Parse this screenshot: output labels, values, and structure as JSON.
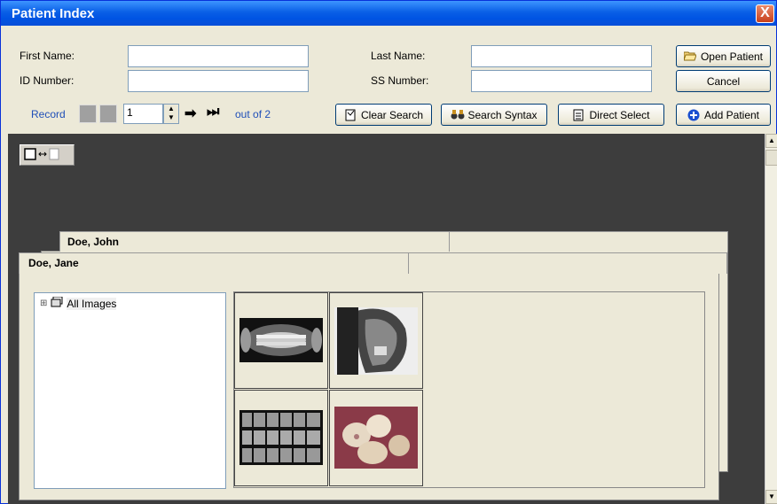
{
  "window": {
    "title": "Patient Index",
    "close_label": "X"
  },
  "search": {
    "first_name_label": "First Name:",
    "first_name_value": "",
    "id_label": "ID Number:",
    "id_value": "",
    "last_name_label": "Last Name:",
    "last_name_value": "",
    "ss_label": "SS Number:",
    "ss_value": ""
  },
  "record_nav": {
    "label": "Record",
    "current": "1",
    "out_of": "out of 2"
  },
  "buttons": {
    "open_patient": "Open Patient",
    "cancel": "Cancel",
    "clear_search": "Clear Search",
    "search_syntax": "Search Syntax",
    "direct_select": "Direct Select",
    "add_patient": "Add Patient"
  },
  "patients": [
    {
      "name": "Doe, John"
    },
    {
      "name": "Doe, Jane"
    }
  ],
  "tree": {
    "root_label": "All Images",
    "expand_glyph": "⊞"
  },
  "images": [
    {
      "name": "panoramic-xray"
    },
    {
      "name": "cephalometric-xray"
    },
    {
      "name": "bitewing-series"
    },
    {
      "name": "intraoral-photo"
    }
  ],
  "colors": {
    "title_bar": "#0054e3",
    "dark_area": "#3d3d3d",
    "window_bg": "#ece9d8"
  }
}
